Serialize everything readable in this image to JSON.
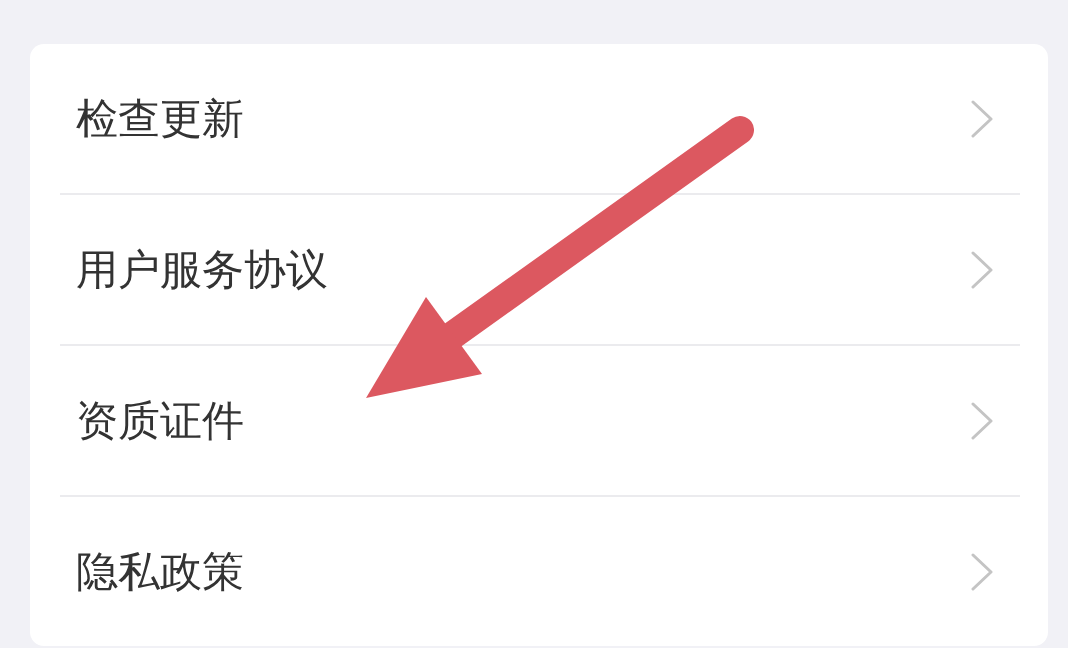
{
  "menu": {
    "items": [
      {
        "label": "检查更新"
      },
      {
        "label": "用户服务协议"
      },
      {
        "label": "资质证件"
      },
      {
        "label": "隐私政策"
      }
    ]
  }
}
